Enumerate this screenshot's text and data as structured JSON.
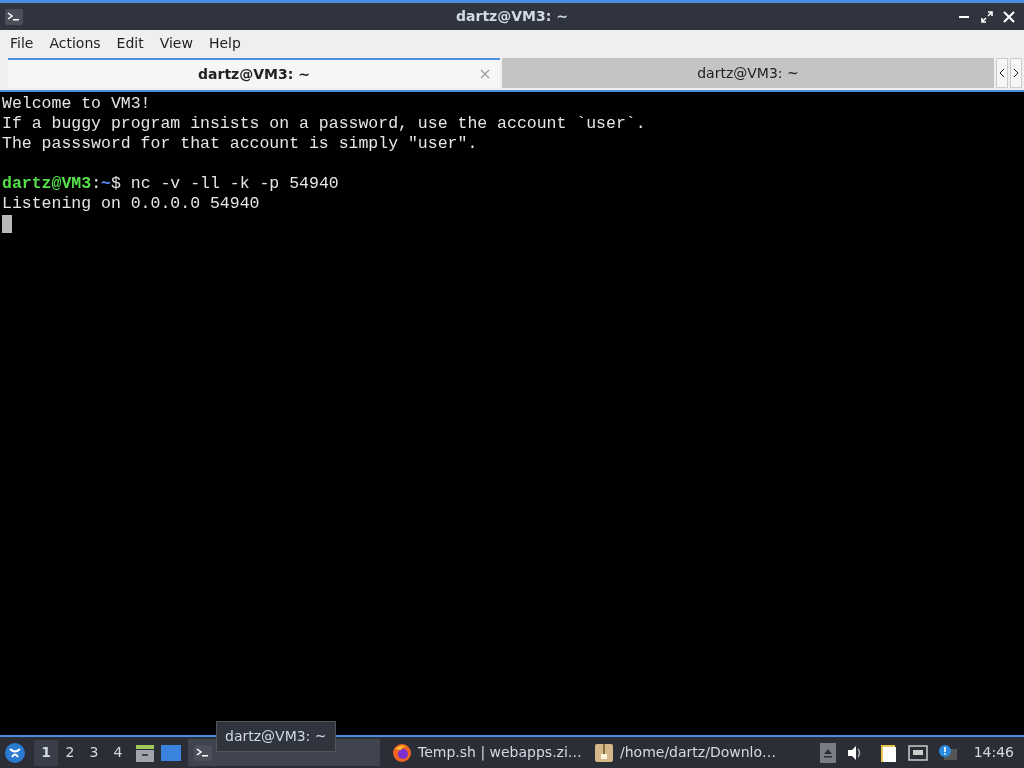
{
  "window": {
    "title": "dartz@VM3: ~"
  },
  "menu": [
    "File",
    "Actions",
    "Edit",
    "View",
    "Help"
  ],
  "tabs": [
    {
      "label": "dartz@VM3: ~",
      "selected": true
    },
    {
      "label": "dartz@VM3: ~",
      "selected": false
    }
  ],
  "terminal": {
    "lines": [
      {
        "kind": "text",
        "text": "Welcome to VM3!"
      },
      {
        "kind": "text",
        "text": "If a buggy program insists on a password, use the account `user`."
      },
      {
        "kind": "text",
        "text": "The passsword for that account is simply \"user\"."
      },
      {
        "kind": "blank"
      },
      {
        "kind": "prompt",
        "user_host": "dartz@VM3",
        "separator": ":",
        "path": "~",
        "symbol": "$",
        "command": " nc -v -ll -k -p 54940"
      },
      {
        "kind": "text",
        "text": "Listening on 0.0.0.0 54940"
      },
      {
        "kind": "cursor"
      }
    ]
  },
  "taskbar": {
    "workspaces": [
      {
        "label": "1",
        "selected": true
      },
      {
        "label": "2",
        "selected": false
      },
      {
        "label": "3",
        "selected": false
      },
      {
        "label": "4",
        "selected": false
      }
    ],
    "tasks": [
      {
        "kind": "terminal",
        "tooltip": "dartz@VM3: ~",
        "selected": true
      },
      {
        "kind": "browser",
        "label": "Temp.sh | webapps.zi…",
        "selected": false
      },
      {
        "kind": "archive",
        "label": "/home/dartz/Downlo…",
        "selected": false
      }
    ],
    "clock": "14:46"
  }
}
